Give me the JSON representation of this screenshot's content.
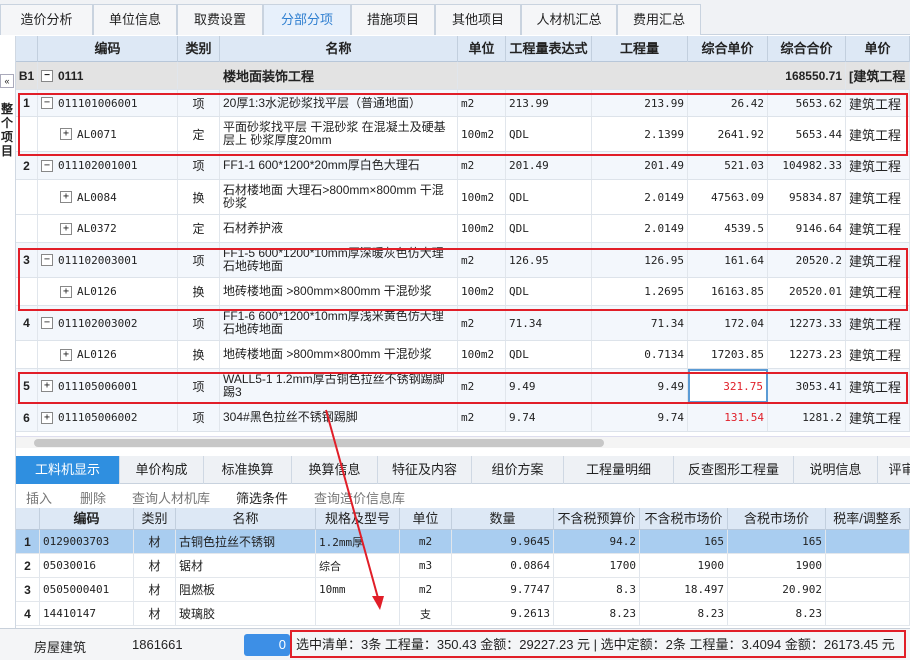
{
  "top_tabs": [
    "造价分析",
    "单位信息",
    "取费设置",
    "分部分项",
    "措施项目",
    "其他项目",
    "人材机汇总",
    "费用汇总"
  ],
  "side": {
    "collapse": "«",
    "label": "整个项目"
  },
  "grid": {
    "headers": [
      "编码",
      "类别",
      "名称",
      "单位",
      "工程量表达式",
      "工程量",
      "综合单价",
      "综合合价",
      "单价"
    ],
    "section": {
      "idx": "B1",
      "code": "0111",
      "name": "楼地面装饰工程",
      "total": "168550.71",
      "prof": "[建筑工程"
    },
    "rows": [
      {
        "idx": "1",
        "tree": "−",
        "code": "011101006001",
        "type": "项",
        "name": "20厚1:3水泥砂浆找平层（普通地面）",
        "unit": "m2",
        "expr": "213.99",
        "qty": "213.99",
        "price": "26.42",
        "total": "5653.62",
        "prof": "建筑工程",
        "kind": "qd"
      },
      {
        "idx": "",
        "tree": "+",
        "code": "AL0071",
        "type": "定",
        "name": "平面砂浆找平层 干混砂浆 在混凝土及硬基层上 砂浆厚度20mm",
        "unit": "100m2",
        "expr": "QDL",
        "qty": "2.1399",
        "price": "2641.92",
        "total": "5653.44",
        "prof": "建筑工程",
        "kind": "de"
      },
      {
        "idx": "2",
        "tree": "−",
        "code": "011102001001",
        "type": "项",
        "name": "FF1-1 600*1200*20mm厚白色大理石",
        "unit": "m2",
        "expr": "201.49",
        "qty": "201.49",
        "price": "521.03",
        "total": "104982.33",
        "prof": "建筑工程",
        "kind": "qd"
      },
      {
        "idx": "",
        "tree": "+",
        "code": "AL0084",
        "type": "换",
        "name": "石材楼地面 大理石>800mm×800mm 干混砂浆",
        "unit": "100m2",
        "expr": "QDL",
        "qty": "2.0149",
        "price": "47563.09",
        "total": "95834.87",
        "prof": "建筑工程",
        "kind": "de"
      },
      {
        "idx": "",
        "tree": "+",
        "code": "AL0372",
        "type": "定",
        "name": "石材养护液",
        "unit": "100m2",
        "expr": "QDL",
        "qty": "2.0149",
        "price": "4539.5",
        "total": "9146.64",
        "prof": "建筑工程",
        "kind": "de"
      },
      {
        "idx": "3",
        "tree": "−",
        "code": "011102003001",
        "type": "项",
        "name": "FF1-5 600*1200*10mm厚深暖灰色仿大理石地砖地面",
        "unit": "m2",
        "expr": "126.95",
        "qty": "126.95",
        "price": "161.64",
        "total": "20520.2",
        "prof": "建筑工程",
        "kind": "qd"
      },
      {
        "idx": "",
        "tree": "+",
        "code": "AL0126",
        "type": "换",
        "name": "地砖楼地面 >800mm×800mm 干混砂浆",
        "unit": "100m2",
        "expr": "QDL",
        "qty": "1.2695",
        "price": "16163.85",
        "total": "20520.01",
        "prof": "建筑工程",
        "kind": "de"
      },
      {
        "idx": "4",
        "tree": "−",
        "code": "011102003002",
        "type": "项",
        "name": "FF1-6 600*1200*10mm厚浅米黄色仿大理石地砖地面",
        "unit": "m2",
        "expr": "71.34",
        "qty": "71.34",
        "price": "172.04",
        "total": "12273.33",
        "prof": "建筑工程",
        "kind": "qd"
      },
      {
        "idx": "",
        "tree": "+",
        "code": "AL0126",
        "type": "换",
        "name": "地砖楼地面 >800mm×800mm 干混砂浆",
        "unit": "100m2",
        "expr": "QDL",
        "qty": "0.7134",
        "price": "17203.85",
        "total": "12273.23",
        "prof": "建筑工程",
        "kind": "de"
      },
      {
        "idx": "5",
        "tree": "+",
        "code": "011105006001",
        "type": "项",
        "name": "WALL5-1 1.2mm厚古铜色拉丝不锈钢踢脚踢3",
        "unit": "m2",
        "expr": "9.49",
        "qty": "9.49",
        "price": "321.75",
        "total": "3053.41",
        "prof": "建筑工程",
        "kind": "qd",
        "red": true
      },
      {
        "idx": "6",
        "tree": "+",
        "code": "011105006002",
        "type": "项",
        "name": "304#黑色拉丝不锈钢踢脚",
        "unit": "m2",
        "expr": "9.74",
        "qty": "9.74",
        "price": "131.54",
        "total": "1281.2",
        "prof": "建筑工程",
        "kind": "qd",
        "red": true
      }
    ]
  },
  "bottom_tabs": [
    "工料机显示",
    "单价构成",
    "标准换算",
    "换算信息",
    "特征及内容",
    "组价方案",
    "工程量明细",
    "反查图形工程量",
    "说明信息",
    "评审"
  ],
  "toolbar": [
    "插入",
    "删除",
    "查询人材机库",
    "筛选条件",
    "查询造价信息库"
  ],
  "res": {
    "headers": [
      "编码",
      "类别",
      "名称",
      "规格及型号",
      "单位",
      "数量",
      "不含税预算价",
      "不含税市场价",
      "含税市场价",
      "税率/调整系"
    ],
    "rows": [
      {
        "idx": "1",
        "code": "0129003703",
        "type": "材",
        "name": "古铜色拉丝不锈钢",
        "spec": "1.2mm厚",
        "unit": "m2",
        "qty": "9.9645",
        "p1": "94.2",
        "p2": "165",
        "p3": "165"
      },
      {
        "idx": "2",
        "code": "05030016",
        "type": "材",
        "name": "锯材",
        "spec": "综合",
        "unit": "m3",
        "qty": "0.0864",
        "p1": "1700",
        "p2": "1900",
        "p3": "1900"
      },
      {
        "idx": "3",
        "code": "0505000401",
        "type": "材",
        "name": "阻燃板",
        "spec": "10mm",
        "unit": "m2",
        "qty": "9.7747",
        "p1": "8.3",
        "p2": "18.497",
        "p3": "20.902"
      },
      {
        "idx": "4",
        "code": "14410147",
        "type": "材",
        "name": "玻璃胶",
        "spec": "",
        "unit": "支",
        "qty": "9.2613",
        "p1": "8.23",
        "p2": "8.23",
        "p3": "8.23"
      }
    ]
  },
  "status": {
    "a": "房屋建筑",
    "b": "1861661",
    "c": "0",
    "sel": "选中清单：3条  工程量：350.43  金额：29227.23 元 | 选中定额：2条  工程量：3.4094  金额：26173.45 元"
  },
  "colors": {
    "accent": "#2f8fe0",
    "red_box": "#e11e28"
  }
}
